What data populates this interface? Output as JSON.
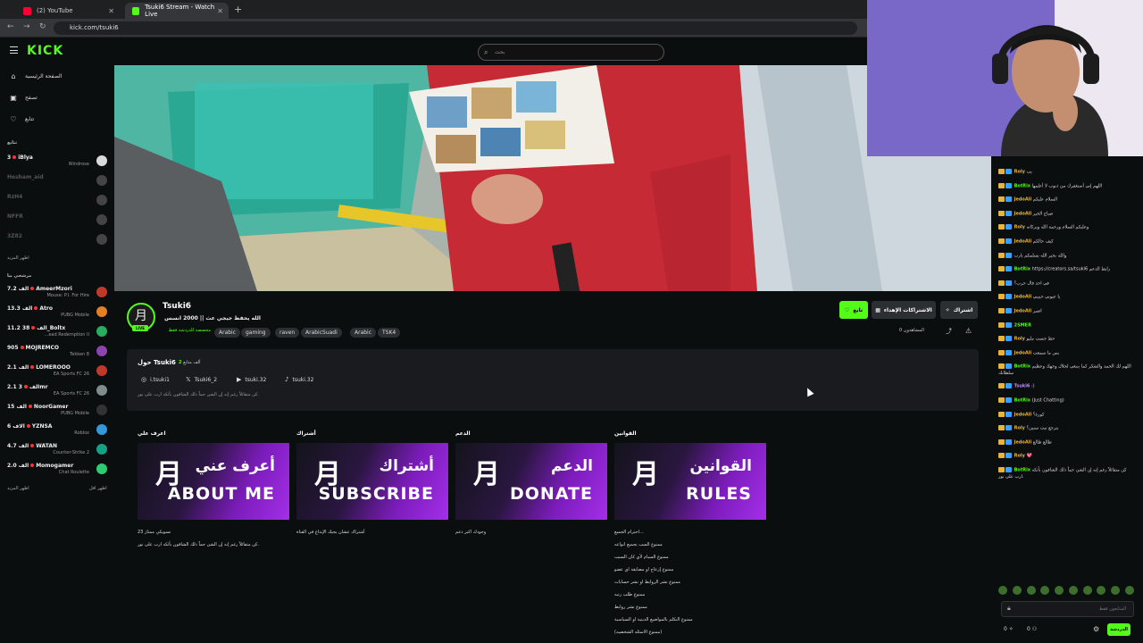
{
  "browser": {
    "tabs": [
      {
        "label": "(2) YouTube",
        "color": "#ff0033"
      },
      {
        "label": "Tsuki6 Stream - Watch Live",
        "color": "#53fc18"
      }
    ],
    "url": "kick.com/tsuki6"
  },
  "header": {
    "logo": "KICK",
    "search_placeholder": "بحث"
  },
  "sidebar": {
    "nav": [
      {
        "label": "الصفحة الرئيسية",
        "icon": "home-icon"
      },
      {
        "label": "تصفح",
        "icon": "browse-icon"
      },
      {
        "label": "تتابع",
        "icon": "heart-icon"
      }
    ],
    "following_header": "تتابع",
    "following": [
      {
        "viewers": "3",
        "name": "iBlya",
        "game": "Windrose",
        "online": true,
        "avatar": "#d9d9d9"
      },
      {
        "viewers": "",
        "name": "Hesham_aid",
        "game": "",
        "online": false,
        "avatar": "#444"
      },
      {
        "viewers": "",
        "name": "RzH4",
        "game": "",
        "online": false,
        "avatar": "#444"
      },
      {
        "viewers": "",
        "name": "NFFR",
        "game": "",
        "online": false,
        "avatar": "#444"
      },
      {
        "viewers": "",
        "name": "3Z82",
        "game": "",
        "online": false,
        "avatar": "#444"
      }
    ],
    "show_more_1": "اظهر المزيد",
    "recommended_header": "مرشحي بيا",
    "recommended": [
      {
        "viewers": "7.2 الف",
        "name": "AmeerMzori",
        "game": "Mouse: P.I. For Hire",
        "avatar": "#c0392b"
      },
      {
        "viewers": "13.3 الف",
        "name": "Atro",
        "game": "PUBG Mobile",
        "avatar": "#e67e22"
      },
      {
        "viewers": "11.2 الف",
        "name": "38_Boltx",
        "game": "...ead Redemption II",
        "avatar": "#27ae60"
      },
      {
        "viewers": "905",
        "name": "MOJREMCO",
        "game": "Tekken 8",
        "avatar": "#8e44ad"
      },
      {
        "viewers": "2.1 الف",
        "name": "LOMEROOO",
        "game": "EA Sports FC 26",
        "avatar": "#c0392b"
      },
      {
        "viewers": "2.1 الف",
        "name": "3mr",
        "game": "EA Sports FC 26",
        "avatar": "#7f8c8d"
      },
      {
        "viewers": "15 الف",
        "name": "NoorGamer",
        "game": "PUBG Mobile",
        "avatar": "#333"
      },
      {
        "viewers": "6 الاف",
        "name": "YZNSA",
        "game": "Roblox",
        "avatar": "#3498db"
      },
      {
        "viewers": "4.7 الف",
        "name": "WATAN",
        "game": "Counter-Strike 2",
        "avatar": "#16a085"
      },
      {
        "viewers": "2.0 الف",
        "name": "Momogamer",
        "game": "Chat Roulette",
        "avatar": "#2ecc71"
      }
    ],
    "show_more_2": "اظهر المزيد",
    "show_less": "اظهر اقل"
  },
  "channel": {
    "name": "Tsuki6",
    "live_badge": "LIVE",
    "title": "الله يحفظ جيجي عث || 2000 انسس",
    "category": "مخصصة للدردشة فقط",
    "tags": [
      "Arabic",
      "gaming",
      "raven",
      "ArabicSuadi",
      "Arabic",
      "TSK4"
    ],
    "follow_label": "تابع",
    "gift_label": "الاشتراكات الإهداء",
    "subscribe_label": "اشتراك",
    "viewers_label": "المشاهدون 0"
  },
  "about": {
    "title": "حول Tsuki6",
    "followers_count": "2",
    "followers_label": "ألف متابع",
    "socials": [
      {
        "icon": "instagram-icon",
        "handle": "i.tsuki1"
      },
      {
        "icon": "x-icon",
        "handle": "Tsuki6_2"
      },
      {
        "icon": "youtube-icon",
        "handle": "tsuki.32"
      },
      {
        "icon": "tiktok-icon",
        "handle": "tsuki.32"
      }
    ],
    "bio": "كن متفائلاً رغم إنه إن الشن جماً ذلك الشافون بأثكه ارب على نور."
  },
  "panels": [
    {
      "title": "اعرف علي",
      "ar": "أعرف عني",
      "en": "ABOUT ME",
      "desc": [
        "تسويكي ممتاز 23",
        "كن متفائلاً رغم إنه إن الشن جماً ذلك الشافون بأثكه ارب على نور."
      ]
    },
    {
      "title": "أشتراك",
      "ar": "أشتراك",
      "en": "SUBSCRIBE",
      "desc": [
        "أشتراك عشان يجيك الإبداع في القناة"
      ]
    },
    {
      "title": "الدعم",
      "ar": "الدعم",
      "en": "DONATE",
      "desc": [
        "وجودك اكبر دعم"
      ]
    },
    {
      "title": "القوانين",
      "ar": "القوانين",
      "en": "RULES",
      "desc": [
        "احترام الجميع...",
        "ممنوع السب بجميع انواعه",
        "ممنوع السبام لأي كان السبب",
        "ممنوع إزعاج او مضايقة اي عضو",
        "ممنوع نشر الروابط او نشر حسابات",
        "ممنوع طلب رتبه",
        "ممنوع نشر روابط",
        "ممنوع التكلم بالمواضيع الدينية او السياسية",
        "(ممنوع الاسئله الشخصيه)"
      ]
    }
  ],
  "chat": {
    "messages": [
      {
        "user": "Roly",
        "color": "#e7b53c",
        "text": "يب"
      },
      {
        "user": "BotRix",
        "color": "#53fc18",
        "text": "اللهم إني أستغفرك من ذنوب لا أعلمها"
      },
      {
        "user": "JedoAli",
        "color": "#e7b53c",
        "text": "السلام عليكم"
      },
      {
        "user": "JedoAli",
        "color": "#e7b53c",
        "text": "صباح الخير"
      },
      {
        "user": "Roly",
        "color": "#e7b53c",
        "text": "وعليكم السلام ورحمة الله وبركاته"
      },
      {
        "user": "JedoAli",
        "color": "#e7b53c",
        "text": "كيف حالكم"
      },
      {
        "user": "",
        "color": "#e7b53c",
        "text": "والله بخير الله يسلمكم يارب"
      },
      {
        "user": "BotRix",
        "color": "#53fc18",
        "text": "https://creators.sa/tsuki6 رابط الدعم"
      },
      {
        "user": "",
        "color": "#e7b53c",
        "text": "في احد قال حرب؟"
      },
      {
        "user": "JedoAli",
        "color": "#e7b53c",
        "text": "يا عيوني حبيبي"
      },
      {
        "user": "JedoAli",
        "color": "#e7b53c",
        "text": "اصبر"
      },
      {
        "user": "2SMER",
        "color": "#53fc18",
        "text": ""
      },
      {
        "user": "Roly",
        "color": "#e7b53c",
        "text": "حط جست مليو"
      },
      {
        "user": "JedoAli",
        "color": "#e7b53c",
        "text": "بس ما سمعت"
      },
      {
        "user": "BotRix",
        "color": "#53fc18",
        "text": "اللهم لك الحمد والشكر كما ينبغي لجلال وجهك وعظيم سلطانك"
      },
      {
        "user": "Tsuki6",
        "color": "#c08cff",
        "text": ":)"
      },
      {
        "user": "BotRix",
        "color": "#53fc18",
        "text": "(Just Chatting)"
      },
      {
        "user": "JedoAli",
        "color": "#e7b53c",
        "text": "كورة؟"
      },
      {
        "user": "Roly",
        "color": "#e7b53c",
        "text": "بترجع تبث سنين؟"
      },
      {
        "user": "JedoAli",
        "color": "#e7b53c",
        "text": "طالع طالع"
      },
      {
        "user": "Roly",
        "color": "#e7b53c",
        "text": "💖"
      },
      {
        "user": "BotRix",
        "color": "#53fc18",
        "text": "كن متفائلاً رغم إنه إن الشن جماً ذلك الشافون بأثكه ارب على نور."
      }
    ],
    "input_placeholder": "المتابعون فقط",
    "send_label": "الدردشة",
    "points": "0",
    "count": "0"
  }
}
